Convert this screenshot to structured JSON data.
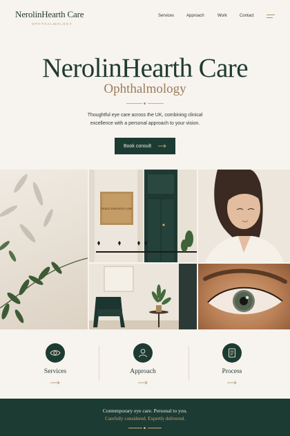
{
  "brand": {
    "name": "NerolinHearth Care",
    "subtitle": "OPHTHALMOLOGY"
  },
  "nav": {
    "items": [
      "Services",
      "Approach",
      "Work",
      "Contact"
    ],
    "menu_icon": "menu-icon"
  },
  "hero": {
    "title": "NerolinHearth Care",
    "subtitle": "Ophthalmology",
    "description": "Thoughtful eye care across the UK, combining clinical excellence with a personal approach to your vision.",
    "cta_label": "Book consult"
  },
  "gallery": {
    "plaque_text": "NEROLINHEARTH CARE"
  },
  "features": [
    {
      "label": "Services",
      "icon": "eye-icon"
    },
    {
      "label": "Approach",
      "icon": "person-icon"
    },
    {
      "label": "Process",
      "icon": "document-icon"
    }
  ],
  "footer": {
    "line1": "Contemporary eye care. Personal to you.",
    "line2": "Carefully considered. Expertly delivered."
  },
  "colors": {
    "brand_green": "#1c3b33",
    "accent_gold": "#b0916a",
    "background": "#f7f3ee"
  }
}
